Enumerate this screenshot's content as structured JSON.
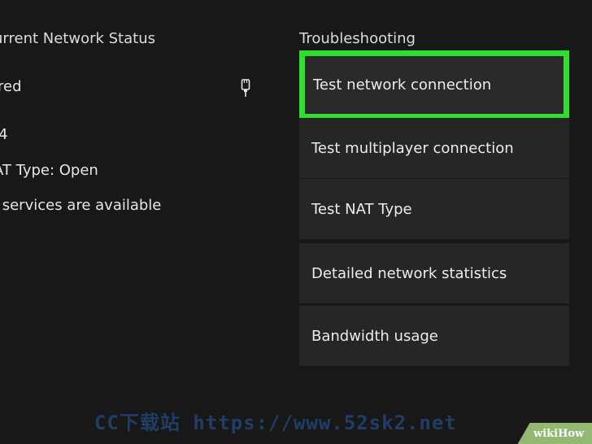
{
  "status": {
    "heading": "urrent Network Status",
    "connection": "ired",
    "ip_version": "/4",
    "nat_type": "AT Type: Open",
    "services": "l services are available",
    "connection_icon": "ethernet-icon"
  },
  "troubleshooting": {
    "heading": "Troubleshooting",
    "items": [
      {
        "label": "Test network connection"
      },
      {
        "label": "Test multiplayer connection"
      },
      {
        "label": "Test NAT Type"
      },
      {
        "label": "Detailed network statistics"
      },
      {
        "label": "Bandwidth usage"
      }
    ],
    "selected_index": 0
  },
  "watermark": {
    "text": "CC下载站 https://www.52sk2.net"
  },
  "badge": {
    "wiki": "wiki",
    "how": "How"
  },
  "colors": {
    "background": "#181818",
    "tile": "#262626",
    "focus_border": "#2ee02e",
    "watermark": "#1f3d66",
    "badge": "#93b874"
  }
}
